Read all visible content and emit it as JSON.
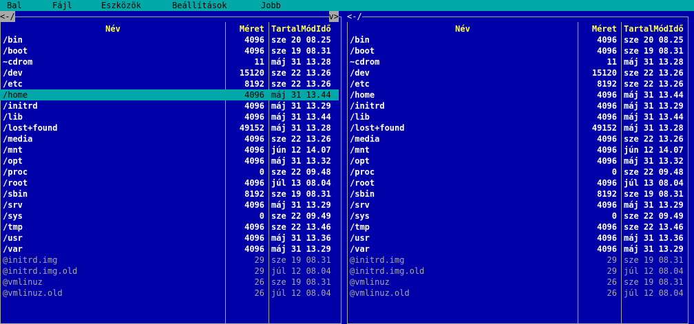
{
  "menubar": {
    "items": [
      "Bal",
      "Fájl",
      "Eszközök",
      "Beállítások",
      "Jobb"
    ]
  },
  "left_panel": {
    "path": "/",
    "prefix": "<-",
    "arrow": "v>",
    "columns": {
      "name": "Név",
      "size": "Méret",
      "mtime": "TartalMódIdő"
    },
    "selected_index": 5,
    "entries": [
      {
        "name": "/bin",
        "size": "4096",
        "mtime": "sze 20 08.25",
        "kind": "dir"
      },
      {
        "name": "/boot",
        "size": "4096",
        "mtime": "sze 19 08.31",
        "kind": "dir"
      },
      {
        "name": "~cdrom",
        "size": "11",
        "mtime": "máj 31 13.28",
        "kind": "dir"
      },
      {
        "name": "/dev",
        "size": "15120",
        "mtime": "sze 22 13.26",
        "kind": "dir"
      },
      {
        "name": "/etc",
        "size": "8192",
        "mtime": "sze 22 13.26",
        "kind": "dir"
      },
      {
        "name": "/home",
        "size": "4096",
        "mtime": "máj 31 13.44",
        "kind": "dir"
      },
      {
        "name": "/initrd",
        "size": "4096",
        "mtime": "máj 31 13.29",
        "kind": "dir"
      },
      {
        "name": "/lib",
        "size": "4096",
        "mtime": "máj 31 13.44",
        "kind": "dir"
      },
      {
        "name": "/lost+found",
        "size": "49152",
        "mtime": "máj 31 13.28",
        "kind": "dir"
      },
      {
        "name": "/media",
        "size": "4096",
        "mtime": "sze 22 13.26",
        "kind": "dir"
      },
      {
        "name": "/mnt",
        "size": "4096",
        "mtime": "jún 12 14.07",
        "kind": "dir"
      },
      {
        "name": "/opt",
        "size": "4096",
        "mtime": "máj 31 13.32",
        "kind": "dir"
      },
      {
        "name": "/proc",
        "size": "0",
        "mtime": "sze 22 09.48",
        "kind": "dir"
      },
      {
        "name": "/root",
        "size": "4096",
        "mtime": "júl 13 08.04",
        "kind": "dir"
      },
      {
        "name": "/sbin",
        "size": "8192",
        "mtime": "sze 19 08.31",
        "kind": "dir"
      },
      {
        "name": "/srv",
        "size": "4096",
        "mtime": "máj 31 13.29",
        "kind": "dir"
      },
      {
        "name": "/sys",
        "size": "0",
        "mtime": "sze 22 09.49",
        "kind": "dir"
      },
      {
        "name": "/tmp",
        "size": "4096",
        "mtime": "sze 22 13.46",
        "kind": "dir"
      },
      {
        "name": "/usr",
        "size": "4096",
        "mtime": "máj 31 13.36",
        "kind": "dir"
      },
      {
        "name": "/var",
        "size": "4096",
        "mtime": "máj 31 13.29",
        "kind": "dir"
      },
      {
        "name": "@initrd.img",
        "size": "29",
        "mtime": "sze 19 08.31",
        "kind": "link"
      },
      {
        "name": "@initrd.img.old",
        "size": "29",
        "mtime": "júl 12 08.04",
        "kind": "link"
      },
      {
        "name": "@vmlinuz",
        "size": "26",
        "mtime": "sze 19 08.31",
        "kind": "link"
      },
      {
        "name": "@vmlinuz.old",
        "size": "26",
        "mtime": "júl 12 08.04",
        "kind": "link"
      }
    ]
  },
  "right_panel": {
    "path": "<-/",
    "columns": {
      "name": "Név",
      "size": "Méret",
      "mtime": "TartalMódIdő"
    },
    "selected_index": -1,
    "entries": [
      {
        "name": "/bin",
        "size": "4096",
        "mtime": "sze 20 08.25",
        "kind": "dir"
      },
      {
        "name": "/boot",
        "size": "4096",
        "mtime": "sze 19 08.31",
        "kind": "dir"
      },
      {
        "name": "~cdrom",
        "size": "11",
        "mtime": "máj 31 13.28",
        "kind": "dir"
      },
      {
        "name": "/dev",
        "size": "15120",
        "mtime": "sze 22 13.26",
        "kind": "dir"
      },
      {
        "name": "/etc",
        "size": "8192",
        "mtime": "sze 22 13.26",
        "kind": "dir"
      },
      {
        "name": "/home",
        "size": "4096",
        "mtime": "máj 31 13.44",
        "kind": "dir"
      },
      {
        "name": "/initrd",
        "size": "4096",
        "mtime": "máj 31 13.29",
        "kind": "dir"
      },
      {
        "name": "/lib",
        "size": "4096",
        "mtime": "máj 31 13.44",
        "kind": "dir"
      },
      {
        "name": "/lost+found",
        "size": "49152",
        "mtime": "máj 31 13.28",
        "kind": "dir"
      },
      {
        "name": "/media",
        "size": "4096",
        "mtime": "sze 22 13.26",
        "kind": "dir"
      },
      {
        "name": "/mnt",
        "size": "4096",
        "mtime": "jún 12 14.07",
        "kind": "dir"
      },
      {
        "name": "/opt",
        "size": "4096",
        "mtime": "máj 31 13.32",
        "kind": "dir"
      },
      {
        "name": "/proc",
        "size": "0",
        "mtime": "sze 22 09.48",
        "kind": "dir"
      },
      {
        "name": "/root",
        "size": "4096",
        "mtime": "júl 13 08.04",
        "kind": "dir"
      },
      {
        "name": "/sbin",
        "size": "8192",
        "mtime": "sze 19 08.31",
        "kind": "dir"
      },
      {
        "name": "/srv",
        "size": "4096",
        "mtime": "máj 31 13.29",
        "kind": "dir"
      },
      {
        "name": "/sys",
        "size": "0",
        "mtime": "sze 22 09.49",
        "kind": "dir"
      },
      {
        "name": "/tmp",
        "size": "4096",
        "mtime": "sze 22 13.46",
        "kind": "dir"
      },
      {
        "name": "/usr",
        "size": "4096",
        "mtime": "máj 31 13.36",
        "kind": "dir"
      },
      {
        "name": "/var",
        "size": "4096",
        "mtime": "máj 31 13.29",
        "kind": "dir"
      },
      {
        "name": "@initrd.img",
        "size": "29",
        "mtime": "sze 19 08.31",
        "kind": "link"
      },
      {
        "name": "@initrd.img.old",
        "size": "29",
        "mtime": "júl 12 08.04",
        "kind": "link"
      },
      {
        "name": "@vmlinuz",
        "size": "26",
        "mtime": "sze 19 08.31",
        "kind": "link"
      },
      {
        "name": "@vmlinuz.old",
        "size": "26",
        "mtime": "júl 12 08.04",
        "kind": "link"
      }
    ]
  },
  "colors": {
    "panel_bg": "#0000a8",
    "menubar_bg": "#00a8a8",
    "selection_bg": "#00a8a8",
    "header_fg": "#ffff54",
    "link_fg": "#a8a8a8"
  }
}
